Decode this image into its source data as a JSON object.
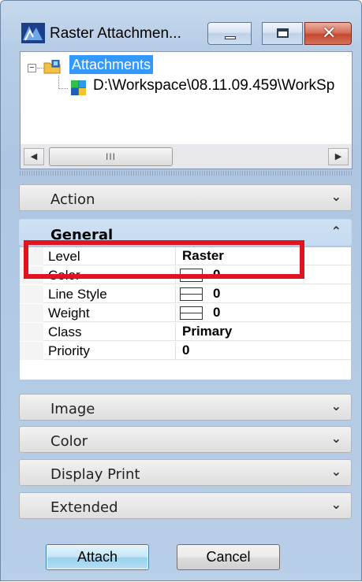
{
  "window": {
    "title": "Raster Attachmen..."
  },
  "tree": {
    "root_label": "Attachments",
    "child_label": "D:\\Workspace\\08.11.09.459\\WorkSp"
  },
  "scrollbar": {
    "thumb_grip": "III"
  },
  "panels": {
    "action": {
      "label": "Action",
      "chevron": "❯"
    },
    "general": {
      "label": "General",
      "chevron": "^"
    },
    "image": {
      "label": "Image"
    },
    "color": {
      "label": "Color"
    },
    "display_print": {
      "label": "Display Print"
    },
    "extended": {
      "label": "Extended"
    }
  },
  "properties": [
    {
      "name": "Level",
      "value": "Raster"
    },
    {
      "name": "Color",
      "value": "0"
    },
    {
      "name": "Line Style",
      "value": "0"
    },
    {
      "name": "Weight",
      "value": "0"
    },
    {
      "name": "Class",
      "value": "Primary"
    },
    {
      "name": "Priority",
      "value": "0"
    }
  ],
  "buttons": {
    "attach": "Attach",
    "cancel": "Cancel"
  },
  "colors": {
    "highlight_box": "#e0141e",
    "selection": "#3399ff"
  }
}
